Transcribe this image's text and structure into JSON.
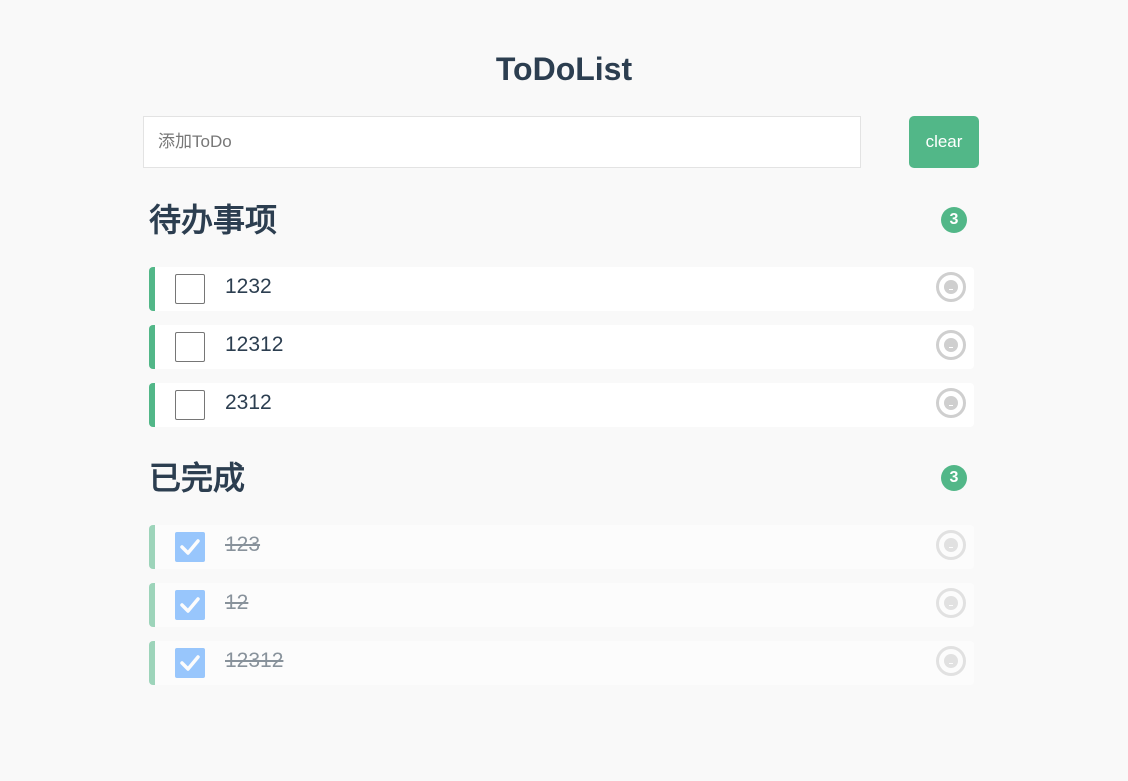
{
  "app": {
    "title": "ToDoList"
  },
  "input": {
    "placeholder": "添加ToDo",
    "value": ""
  },
  "clear_button": {
    "label": "clear"
  },
  "pending": {
    "title": "待办事项",
    "count": "3",
    "items": [
      {
        "text": "1232",
        "checked": false
      },
      {
        "text": "12312",
        "checked": false
      },
      {
        "text": "2312",
        "checked": false
      }
    ]
  },
  "done": {
    "title": "已完成",
    "count": "3",
    "items": [
      {
        "text": "123",
        "checked": true
      },
      {
        "text": "12",
        "checked": true
      },
      {
        "text": "12312",
        "checked": true
      }
    ]
  },
  "colors": {
    "accent": "#52b788",
    "checked": "#4a9eff",
    "text": "#2c3e50",
    "background": "#f9f9f9"
  },
  "icons": {
    "delete": "minus-circle-icon",
    "check": "checkmark-icon"
  }
}
